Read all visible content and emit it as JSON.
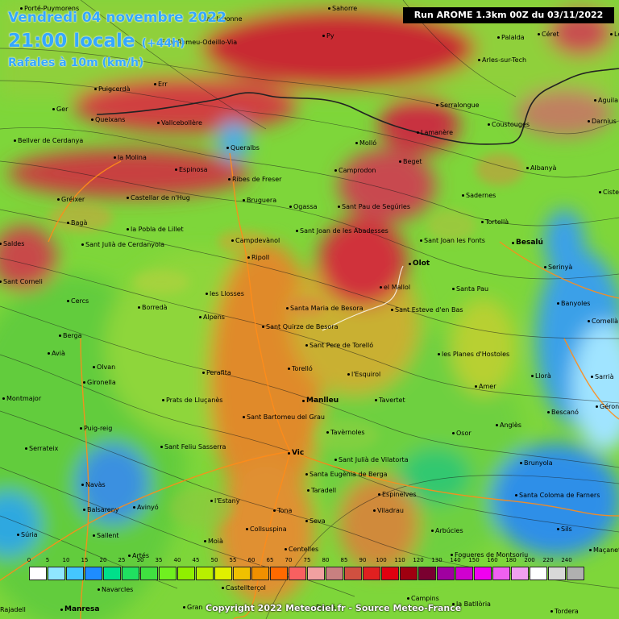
{
  "header": {
    "date": "Vendredi 04 novembre 2022",
    "local_time": "21:00 locale",
    "lead": "(+44h)",
    "parameter": "Rafales à 10m (km/h)"
  },
  "run_info": "Run AROME 1.3km 00Z du 03/11/2022",
  "copyright": "Copyright 2022 Meteociel.fr - Source Meteo-France",
  "legend": {
    "labels": [
      "0",
      "5",
      "10",
      "15",
      "20",
      "25",
      "30",
      "35",
      "40",
      "45",
      "50",
      "55",
      "60",
      "65",
      "70",
      "75",
      "80",
      "85",
      "90",
      "100",
      "110",
      "120",
      "130",
      "140",
      "150",
      "160",
      "180",
      "200",
      "220",
      "240"
    ],
    "colors": [
      "#ffffff",
      "#8fe6ff",
      "#44c6ff",
      "#1e8cff",
      "#00e08a",
      "#20e060",
      "#40e040",
      "#70f020",
      "#90f000",
      "#b8f000",
      "#e0f000",
      "#f0c000",
      "#f09000",
      "#ff6a00",
      "#f86060",
      "#f0a0a0",
      "#c88080",
      "#d05040",
      "#e02020",
      "#e00010",
      "#a00010",
      "#7a0030",
      "#a000a0",
      "#d000d0",
      "#f000f0",
      "#f060f0",
      "#f0a0f0",
      "#ffffff",
      "#d8d8d8",
      "#b0b0b0"
    ]
  },
  "towns": [
    {
      "name": "Porté-Puymorens"
    },
    {
      "name": "La Llagonne"
    },
    {
      "name": "Sahorre"
    },
    {
      "name": "Palalda"
    },
    {
      "name": "Céret"
    },
    {
      "name": "Les Clu"
    },
    {
      "name": "Font-Romeu-Odeillo-Via"
    },
    {
      "name": "Py"
    },
    {
      "name": "Arles-sur-Tech"
    },
    {
      "name": "Puigcerdà"
    },
    {
      "name": "Err"
    },
    {
      "name": "Ger"
    },
    {
      "name": "Queixans"
    },
    {
      "name": "Serralongue"
    },
    {
      "name": "Aguila"
    },
    {
      "name": "Vallcebollère"
    },
    {
      "name": "Coustouges"
    },
    {
      "name": "Darnius"
    },
    {
      "name": "Bellver de Cerdanya"
    },
    {
      "name": "Queralbs"
    },
    {
      "name": "Molló"
    },
    {
      "name": "Lamanère"
    },
    {
      "name": "la Molina"
    },
    {
      "name": "Beget"
    },
    {
      "name": "Espinosa"
    },
    {
      "name": "Ribes de Freser"
    },
    {
      "name": "Camprodon"
    },
    {
      "name": "Albanyà"
    },
    {
      "name": "Gréixer"
    },
    {
      "name": "Castellar de n'Hug"
    },
    {
      "name": "Bruguera"
    },
    {
      "name": "Ogassa"
    },
    {
      "name": "Sant Pau de Segúries"
    },
    {
      "name": "Sadernes"
    },
    {
      "name": "Ciste"
    },
    {
      "name": "Bagà"
    },
    {
      "name": "Tortellà"
    },
    {
      "name": "la Pobla de Lillet"
    },
    {
      "name": "Sant Joan de les Abadesses"
    },
    {
      "name": "Sant Joan les Fonts"
    },
    {
      "name": "Besalú"
    },
    {
      "name": "Saldes"
    },
    {
      "name": "Sant Julià de Cerdanyola"
    },
    {
      "name": "Campdevànol"
    },
    {
      "name": "Ripoll"
    },
    {
      "name": "Olot"
    },
    {
      "name": "Serinyà"
    },
    {
      "name": "Sant Corneli"
    },
    {
      "name": "el Mallol"
    },
    {
      "name": "Santa Pau"
    },
    {
      "name": "les Llosses"
    },
    {
      "name": "Banyoles"
    },
    {
      "name": "Cercs"
    },
    {
      "name": "Borredà"
    },
    {
      "name": "Alpens"
    },
    {
      "name": "Santa Maria de Besora"
    },
    {
      "name": "Sant Esteve d'en Bas"
    },
    {
      "name": "Cornellà"
    },
    {
      "name": "Berga"
    },
    {
      "name": "Sant Quirze de Besora"
    },
    {
      "name": "Avià"
    },
    {
      "name": "Olvan"
    },
    {
      "name": "Sant Pere de Torelló"
    },
    {
      "name": "les Planes d'Hostoles"
    },
    {
      "name": "Gironella"
    },
    {
      "name": "Perafita"
    },
    {
      "name": "Torelló"
    },
    {
      "name": "l'Esquirol"
    },
    {
      "name": "Llorà"
    },
    {
      "name": "Sarrià"
    },
    {
      "name": "Montmajor"
    },
    {
      "name": "Prats de Lluçanès"
    },
    {
      "name": "Manlleu"
    },
    {
      "name": "Amer"
    },
    {
      "name": "Tavertet"
    },
    {
      "name": "Géron"
    },
    {
      "name": "Puig-reig"
    },
    {
      "name": "Sant Bartomeu del Grau"
    },
    {
      "name": "Bescanó"
    },
    {
      "name": "Anglès"
    },
    {
      "name": "Tavèrnoles"
    },
    {
      "name": "Osor"
    },
    {
      "name": "Serrateix"
    },
    {
      "name": "Sant Feliu Sasserra"
    },
    {
      "name": "Vic"
    },
    {
      "name": "Sant Julià de Vilatorta"
    },
    {
      "name": "Brunyola"
    },
    {
      "name": "Santa Eugènia de Berga"
    },
    {
      "name": "Navàs"
    },
    {
      "name": "Taradell"
    },
    {
      "name": "l'Estany"
    },
    {
      "name": "Espinelves"
    },
    {
      "name": "Balsareny"
    },
    {
      "name": "Avinyó"
    },
    {
      "name": "Tona"
    },
    {
      "name": "Viladrau"
    },
    {
      "name": "Santa Coloma de Farners"
    },
    {
      "name": "Seva"
    },
    {
      "name": "Súria"
    },
    {
      "name": "Sallent"
    },
    {
      "name": "Collsuspina"
    },
    {
      "name": "Arbúcies"
    },
    {
      "name": "Sils"
    },
    {
      "name": "Moià"
    },
    {
      "name": "Centelles"
    },
    {
      "name": "Fogueres de Montsoriu"
    },
    {
      "name": "Artés"
    },
    {
      "name": "Navarcles"
    },
    {
      "name": "Castellterçol"
    },
    {
      "name": "Campins"
    },
    {
      "name": "Manresa"
    },
    {
      "name": "Rajadell"
    },
    {
      "name": "Gran"
    },
    {
      "name": "Figaró"
    },
    {
      "name": "la Batllòria"
    },
    {
      "name": "Tordera"
    },
    {
      "name": "Maçanet de la Selva"
    }
  ]
}
